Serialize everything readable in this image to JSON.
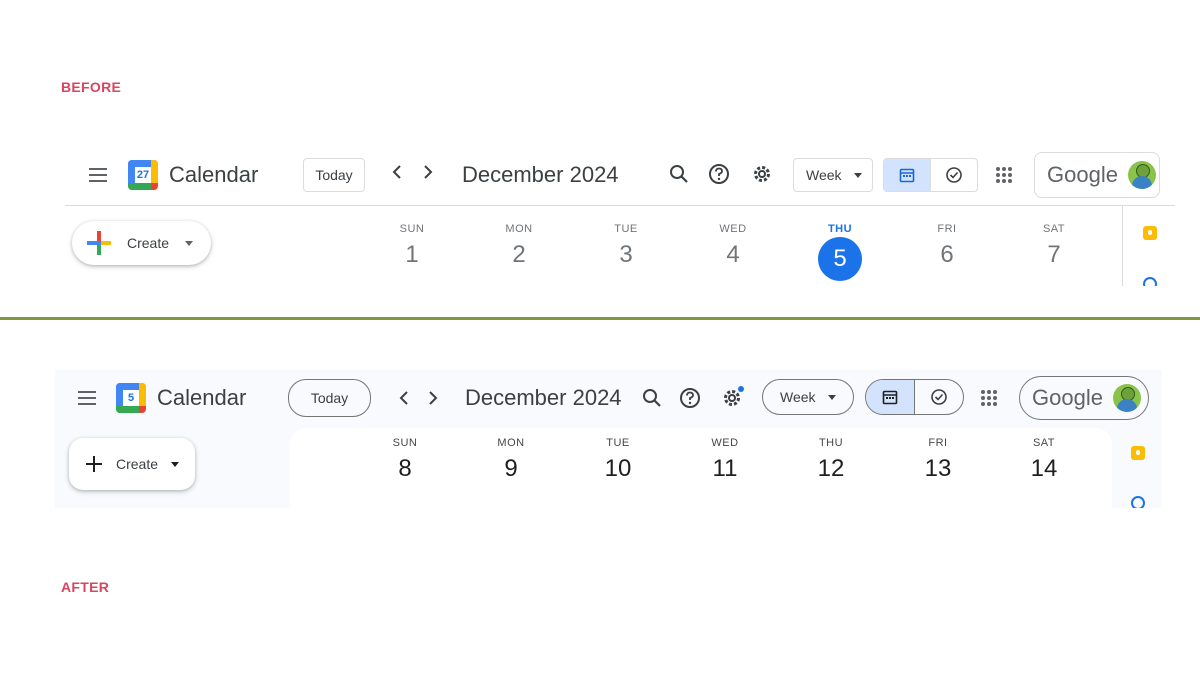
{
  "labels": {
    "before": "BEFORE",
    "after": "AFTER"
  },
  "colors": {
    "label": "#d9455f",
    "divider": "#7f9a3c",
    "today_circle": "#1a73e8",
    "selected_toggle": "#d3e3fd",
    "after_bg": "#f8fafd"
  },
  "before": {
    "app_name": "Calendar",
    "logo_day": "27",
    "today_label": "Today",
    "prev_icon": "chevron-left-icon",
    "next_icon": "chevron-right-icon",
    "month_title": "December 2024",
    "view_select": "Week",
    "google_label": "Google",
    "create_label": "Create",
    "days": [
      {
        "name": "SUN",
        "num": "1"
      },
      {
        "name": "MON",
        "num": "2"
      },
      {
        "name": "TUE",
        "num": "3"
      },
      {
        "name": "WED",
        "num": "4"
      },
      {
        "name": "THU",
        "num": "5",
        "today": true
      },
      {
        "name": "FRI",
        "num": "6"
      },
      {
        "name": "SAT",
        "num": "7"
      }
    ]
  },
  "after": {
    "app_name": "Calendar",
    "logo_day": "5",
    "today_label": "Today",
    "prev_icon": "chevron-left-icon",
    "next_icon": "chevron-right-icon",
    "month_title": "December 2024",
    "view_select": "Week",
    "google_label": "Google",
    "create_label": "Create",
    "days": [
      {
        "name": "SUN",
        "num": "8"
      },
      {
        "name": "MON",
        "num": "9"
      },
      {
        "name": "TUE",
        "num": "10"
      },
      {
        "name": "WED",
        "num": "11"
      },
      {
        "name": "THU",
        "num": "12"
      },
      {
        "name": "FRI",
        "num": "13"
      },
      {
        "name": "SAT",
        "num": "14"
      }
    ]
  }
}
